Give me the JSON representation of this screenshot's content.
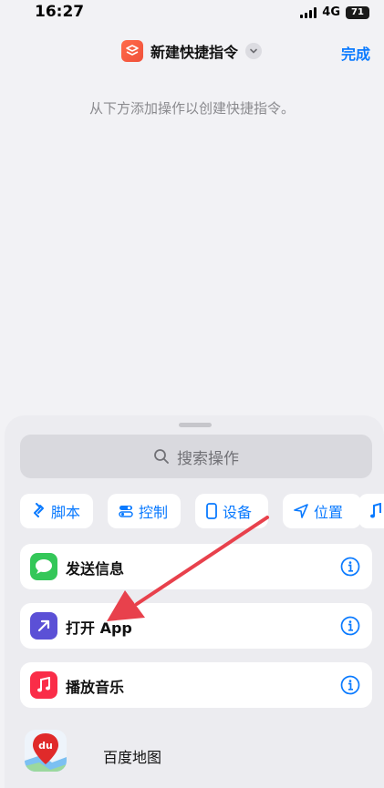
{
  "status": {
    "time": "16:27",
    "network": "4G",
    "battery": "71"
  },
  "nav": {
    "title": "新建快捷指令",
    "done_label": "完成"
  },
  "hint": "从下方添加操作以创建快捷指令。",
  "search": {
    "placeholder": "搜索操作"
  },
  "chips": [
    {
      "label": "脚本",
      "icon": "script-icon"
    },
    {
      "label": "控制",
      "icon": "toggle-icon"
    },
    {
      "label": "设备",
      "icon": "phone-icon"
    },
    {
      "label": "位置",
      "icon": "location-arrow-icon"
    },
    {
      "label": "",
      "icon": "music-note-icon"
    }
  ],
  "actions": [
    {
      "label": "发送信息",
      "icon": "messages-icon",
      "color": "#34c759"
    },
    {
      "label": "打开 App",
      "icon": "open-app-arrow-icon",
      "color": "#5b50d6"
    },
    {
      "label": "播放音乐",
      "icon": "music-icon",
      "color": "#fa2d48"
    }
  ],
  "suggested_app": {
    "label": "百度地图",
    "icon": "baidu-maps-icon",
    "icon_text": "du"
  },
  "colors": {
    "accent": "#0a7aff",
    "annotation": "#e8414c"
  }
}
